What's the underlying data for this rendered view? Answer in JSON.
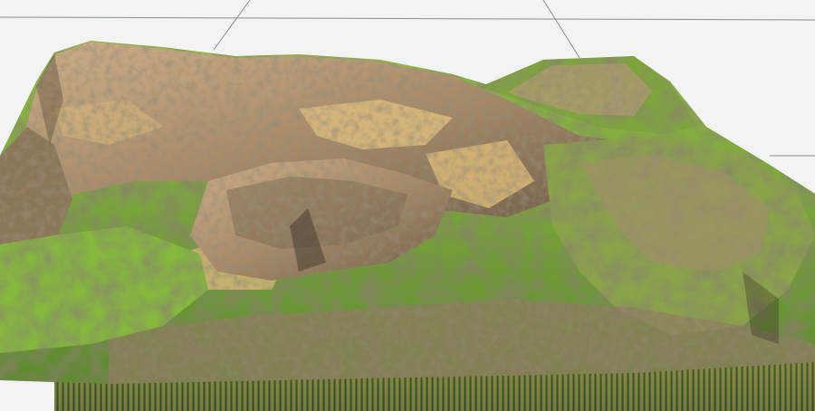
{
  "scene": {
    "subject": "terrain-heightfield-render",
    "background_color": "#f3f3f3",
    "guide_line_color": "#8c8c8c",
    "palette": {
      "grass_light": "#7fb03a",
      "grass_dark": "#4f7a2a",
      "rock_tan": "#c9a878",
      "rock_dark": "#6b5a46",
      "sand": "#dcbc7e",
      "shadow": "#3a3026"
    }
  }
}
